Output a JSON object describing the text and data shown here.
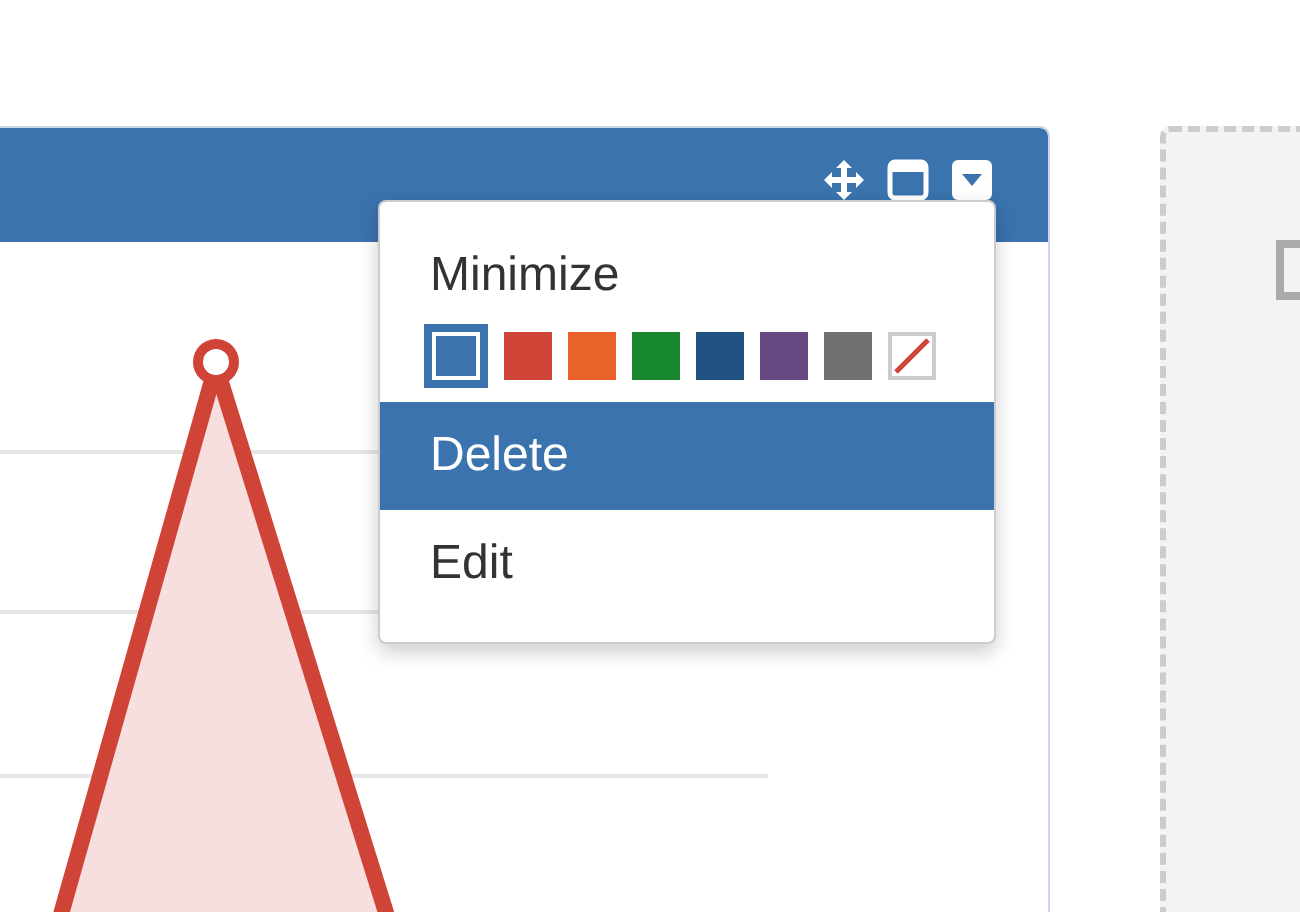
{
  "menu": {
    "items": [
      {
        "kind": "item",
        "label": "Minimize",
        "selected": false
      },
      {
        "kind": "swatches",
        "swatches": [
          {
            "kind": "color",
            "color": "#3a73ad",
            "selected": true
          },
          {
            "kind": "color",
            "color": "#d04437",
            "selected": false
          },
          {
            "kind": "color",
            "color": "#ea632b",
            "selected": false
          },
          {
            "kind": "color",
            "color": "#178830",
            "selected": false
          },
          {
            "kind": "color",
            "color": "#215082",
            "selected": false
          },
          {
            "kind": "color",
            "color": "#654982",
            "selected": false
          },
          {
            "kind": "color",
            "color": "#707070",
            "selected": false
          },
          {
            "kind": "none",
            "selected": false
          }
        ]
      },
      {
        "kind": "item",
        "label": "Delete",
        "selected": true
      },
      {
        "kind": "item",
        "label": "Edit",
        "selected": false
      }
    ]
  }
}
